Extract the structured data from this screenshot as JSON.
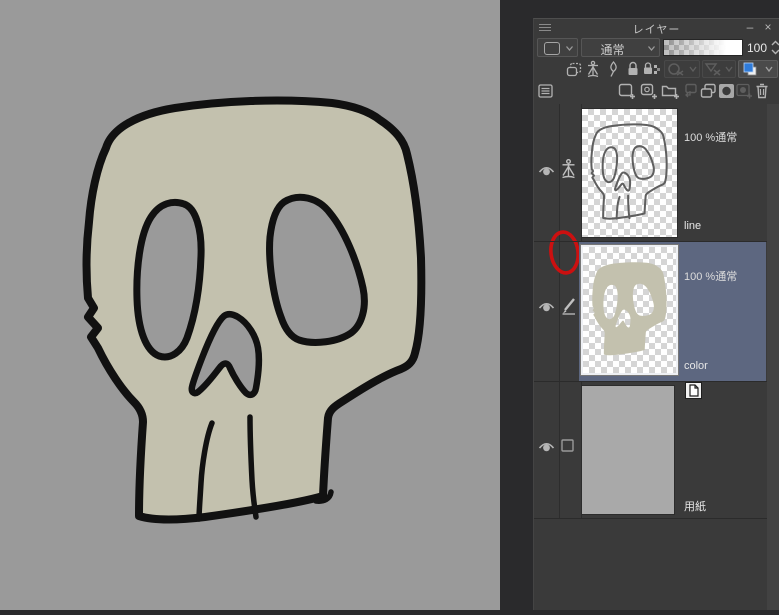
{
  "window": {
    "title": "レイヤー",
    "minimize_label": "–",
    "close_label": "×"
  },
  "toolbar": {
    "layer_kind_dropdown": "rounded-square-icon",
    "blend_mode": "通常",
    "opacity_value": "100",
    "property_icons": [
      "clip-at-layer-below-icon",
      "draft-layer-icon",
      "pin-icon",
      "lock-layer-icon",
      "lock-transparent-pixels-icon",
      "mask-disabled-dropdown",
      "reference-disabled-dropdown",
      "layer-color-dropdown"
    ],
    "action_icons": [
      "layer-menu-icon",
      "new-raster-layer-icon",
      "new-layer-settings-icon",
      "new-folder-icon",
      "transfer-to-lower-icon",
      "combine-to-lower-icon",
      "create-mask-icon",
      "apply-mask-icon",
      "delete-layer-icon"
    ]
  },
  "layers": [
    {
      "info": "100 %通常",
      "name": "line",
      "selected": false,
      "statuses": [
        "visible",
        "draft"
      ],
      "annotation": "red-circle around draft icon"
    },
    {
      "info": "100 %通常",
      "name": "color",
      "selected": true,
      "statuses": [
        "visible",
        "editing"
      ]
    },
    {
      "info": "",
      "name": "用紙",
      "selected": false,
      "statuses": [
        "visible",
        "checkbox"
      ],
      "badge": "paper-icon"
    }
  ],
  "colors": {
    "canvas_background": "#9a9a9a",
    "skull_fill": "#c3c1ae",
    "skull_line": "#111111",
    "panel_background": "#3a3a3a",
    "selected_row": "#5d6780",
    "layer_color_blue": "#2f7bd9",
    "annotation_red": "#cc1010"
  }
}
